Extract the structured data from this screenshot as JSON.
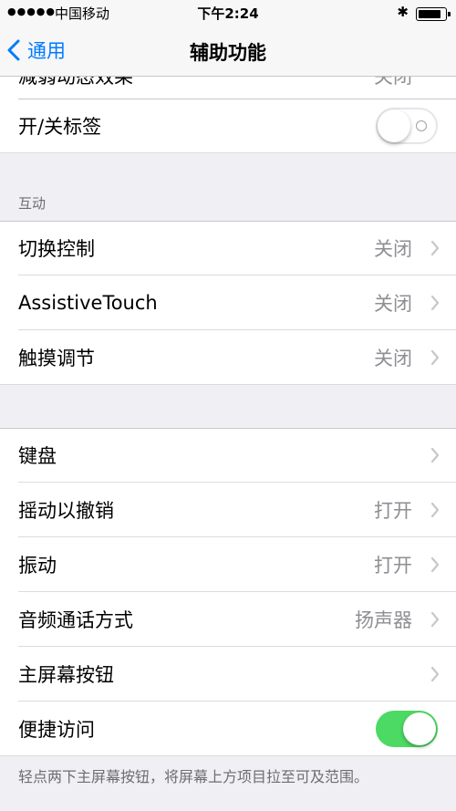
{
  "status_bar": {
    "signal": "●●●●●",
    "carrier": "中国移动",
    "time": "下午2:24",
    "bluetooth": "✱"
  },
  "nav": {
    "back_label": "通用",
    "title": "辅助功能"
  },
  "clipped_row": {
    "label": "减弱动态效果",
    "value": "关闭"
  },
  "toggle_row": {
    "label": "开/关标签",
    "state": "off"
  },
  "interaction_section": {
    "header": "互动",
    "rows": [
      {
        "label": "切换控制",
        "value": "关闭"
      },
      {
        "label": "AssistiveTouch",
        "value": "关闭"
      },
      {
        "label": "触摸调节",
        "value": "关闭"
      }
    ]
  },
  "settings_section": {
    "rows": [
      {
        "label": "键盘",
        "value": ""
      },
      {
        "label": "摇动以撤销",
        "value": "打开"
      },
      {
        "label": "振动",
        "value": "打开"
      },
      {
        "label": "音频通话方式",
        "value": "扬声器"
      },
      {
        "label": "主屏幕按钮",
        "value": ""
      }
    ]
  },
  "reachability": {
    "label": "便捷访问",
    "state": "on",
    "footer": "轻点两下主屏幕按钮，将屏幕上方项目拉至可及范围。"
  },
  "colors": {
    "accent": "#007aff",
    "toggle_on": "#4cd964",
    "background": "#efeff4"
  }
}
